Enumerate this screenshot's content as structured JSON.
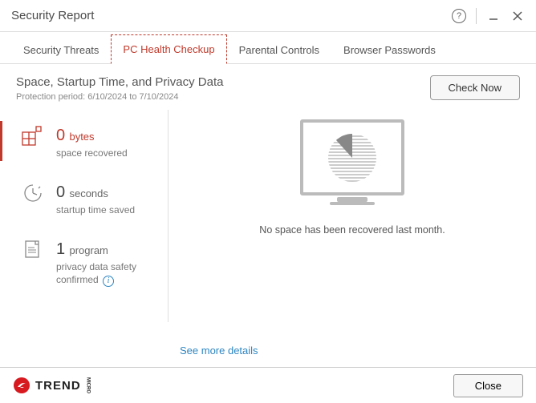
{
  "window": {
    "title": "Security Report",
    "help_tooltip": "Help"
  },
  "tabs": [
    {
      "label": "Security Threats",
      "active": false
    },
    {
      "label": "PC Health Checkup",
      "active": true
    },
    {
      "label": "Parental Controls",
      "active": false
    },
    {
      "label": "Browser Passwords",
      "active": false
    }
  ],
  "header": {
    "title": "Space, Startup Time, and Privacy Data",
    "subtitle": "Protection period: 6/10/2024 to 7/10/2024",
    "check_now": "Check Now"
  },
  "stats": {
    "space": {
      "value": "0",
      "unit": "bytes",
      "desc": "space recovered"
    },
    "startup": {
      "value": "0",
      "unit": "seconds",
      "desc": "startup time saved"
    },
    "privacy": {
      "value": "1",
      "unit": "program",
      "desc": "privacy data safety confirmed"
    }
  },
  "right": {
    "message": "No space has been recovered last month."
  },
  "links": {
    "see_more": "See more details"
  },
  "footer": {
    "brand": "TREND",
    "brand_sub": "MICRO",
    "close": "Close"
  }
}
